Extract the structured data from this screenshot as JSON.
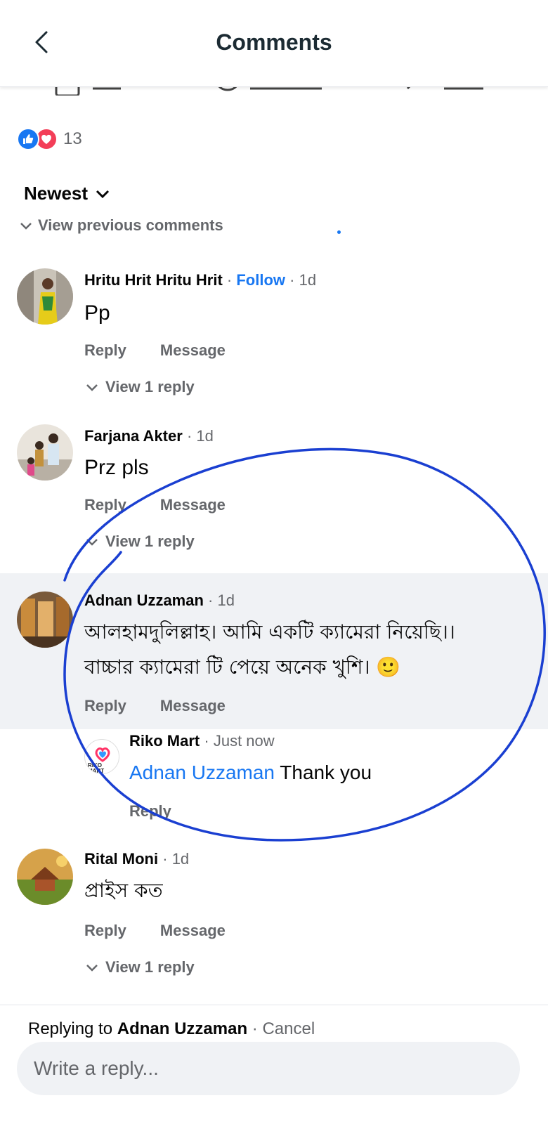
{
  "header": {
    "title": "Comments"
  },
  "reactions": {
    "count": "13"
  },
  "sort": {
    "label": "Newest"
  },
  "view_previous": "View previous comments",
  "comments": [
    {
      "author": "Hritu Hrit Hritu Hrit",
      "follow": "Follow",
      "time": "1d",
      "text": "Pp",
      "reply": "Reply",
      "message": "Message",
      "view_replies": "View 1 reply"
    },
    {
      "author": "Farjana Akter",
      "time": "1d",
      "text": "Prz pls",
      "reply": "Reply",
      "message": "Message",
      "view_replies": "View 1 reply"
    },
    {
      "author": "Adnan Uzzaman",
      "time": "1d",
      "text_line1": "আলহামদুলিল্লাহ।  আমি একটি ক্যামেরা নিয়েছি।।",
      "text_line2": "বাচ্চার ক্যামেরা টি পেয়ে অনেক খুশি। 🙂",
      "reply": "Reply",
      "message": "Message"
    },
    {
      "author": "Rital Moni",
      "time": "1d",
      "text": "প্রাইস কত",
      "reply": "Reply",
      "message": "Message",
      "view_replies": "View 1 reply"
    }
  ],
  "nested_reply": {
    "author": "Riko Mart",
    "time": "Just now",
    "mention": "Adnan Uzzaman",
    "text": "Thank you",
    "reply": "Reply",
    "avatar_text": "RIKO MART"
  },
  "footer": {
    "replying_prefix": "Replying to",
    "replying_name": "Adnan Uzzaman",
    "cancel": "Cancel",
    "placeholder": "Write a reply..."
  },
  "colors": {
    "accent": "#1877f2",
    "highlight_bg": "#f0f2f5",
    "annotation": "#1a3fd1"
  }
}
